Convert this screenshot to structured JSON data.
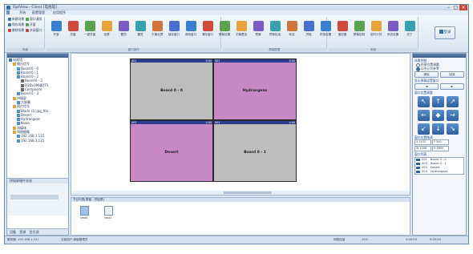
{
  "window": {
    "title": "OptView - Client [电视墙]"
  },
  "menu": [
    "开始",
    "配置管理",
    "应用程序"
  ],
  "ribbon": {
    "small_cmds": [
      "新建场景",
      "保存场景",
      "删除场景",
      "窗口漫游",
      "开窗",
      "关闭窗口"
    ],
    "big_cmds": [
      "开窗",
      "关窗",
      "一键关窗",
      "全屏",
      "置顶",
      "置底",
      "平铺全屏",
      "保存窗口",
      "调用窗口",
      "清除窗口",
      "屏幕设置",
      "字幕叠加",
      "预案",
      "预案轮巡",
      "轮巡",
      "拼接",
      "拼接设置",
      "遥控器",
      "屏幕控制",
      "定时计划",
      "系统设置",
      "关于"
    ],
    "groups": [
      "场景",
      "窗口操作",
      "屏幕配置",
      "系统"
    ],
    "login": "登录"
  },
  "tree": [
    {
      "label": "电视墙",
      "level": 0
    },
    {
      "label": "输出信号",
      "level": 1
    },
    {
      "label": "Board 0 - 0",
      "level": 2
    },
    {
      "label": "Board 0 - 1",
      "level": 2
    },
    {
      "label": "Board 0 - 2",
      "level": 2
    },
    {
      "label": "Board 0 - 2",
      "level": 3
    },
    {
      "label": "D2Dx3968OTS",
      "level": 3
    },
    {
      "label": "Composite",
      "level": 3
    },
    {
      "label": "Board 0 - 3",
      "level": 2
    },
    {
      "label": "拼接屏",
      "level": 1
    },
    {
      "label": "大屏幕",
      "level": 2
    },
    {
      "label": "图片信号",
      "level": 1
    },
    {
      "label": "Blade (1).jpg_ttlx",
      "level": 2
    },
    {
      "label": "Desert",
      "level": 2
    },
    {
      "label": "Hydrangeas",
      "level": 2
    },
    {
      "label": "Koala",
      "level": 2
    },
    {
      "label": "流媒体",
      "level": 1
    },
    {
      "label": "网络摄像",
      "level": 1
    },
    {
      "label": "192.168.1.115",
      "level": 2
    },
    {
      "label": "192.168.1.115",
      "level": 2
    }
  ],
  "left_bottom": {
    "title": "拼接屏硬件状态",
    "tabs": [
      "设备",
      "资源",
      "信号源"
    ]
  },
  "wall": {
    "windows": [
      {
        "name": "Board 0 - 0",
        "id": "001",
        "res": "0.00"
      },
      {
        "name": "Hydrangeas",
        "id": "002",
        "res": "0.00"
      },
      {
        "name": "Desert",
        "id": "003",
        "res": "0.00"
      },
      {
        "name": "Board 0 - 1",
        "id": "004",
        "res": "0.00"
      }
    ]
  },
  "programs": {
    "header": "节目列表[屏幕 - 拼接屏]",
    "items": [
      "test0",
      "test1"
    ]
  },
  "page_tabs": "◄  ◄  ►  ►  电视墙",
  "right": {
    "scene_hd": "场景控制",
    "radios": [
      "任意位置调整",
      "以中心为参考"
    ],
    "btn_a": "清除",
    "btn_b": "回放",
    "move_hd": "显示屏幕设置窗口",
    "pos_hd": "窗口位置调整",
    "size_hd": "窗口位置微调",
    "fields": [
      "X 1152",
      "Y 540",
      "W 1008",
      "H 1609"
    ],
    "list_hd": "窗口列表",
    "list": [
      {
        "id": "001",
        "name": "Board 0 - 0"
      },
      {
        "id": "002",
        "name": "Board 0 - 1"
      },
      {
        "id": "003",
        "name": "Desert"
      },
      {
        "id": "004",
        "name": "Hydrangeas"
      }
    ]
  },
  "status": {
    "left": "服务器: 192.168.1.101",
    "mid": "当前用户:超级管理员",
    "net": "网络连接",
    "zoom": "25%",
    "time1": "9:09:59",
    "time2": "9:09:59"
  }
}
